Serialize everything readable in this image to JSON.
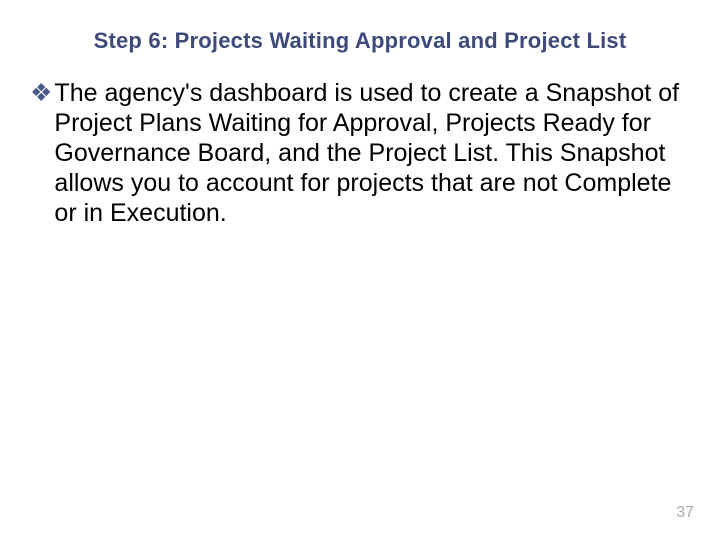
{
  "slide": {
    "title": "Step 6: Projects Waiting Approval and Project List",
    "bullet_glyph": "❖",
    "body": "The agency's dashboard is used to create a Snapshot of Project Plans Waiting for Approval, Projects Ready for Governance Board, and the Project List. This Snapshot allows you to account for projects that are not Complete or in Execution.",
    "page_number": "37"
  }
}
